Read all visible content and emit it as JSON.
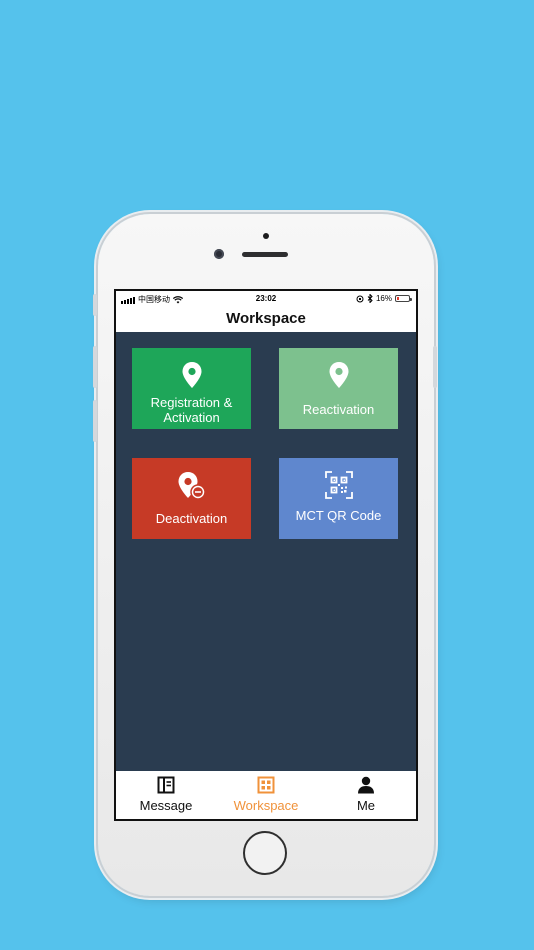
{
  "status_bar": {
    "carrier": "中国移动",
    "time": "23:02",
    "battery_percent": "16%",
    "battery_level": 0.16
  },
  "nav": {
    "title": "Workspace"
  },
  "tiles": [
    {
      "label": "Registration & Activation",
      "icon": "location-pin-icon",
      "color": "#1ea659"
    },
    {
      "label": "Reactivation",
      "icon": "location-pin-icon",
      "color": "#7dc18e"
    },
    {
      "label": "Deactivation",
      "icon": "location-pin-minus-icon",
      "color": "#c63a26"
    },
    {
      "label": "MCT QR Code",
      "icon": "qr-code-icon",
      "color": "#5f87ce"
    }
  ],
  "tabs": [
    {
      "label": "Message",
      "icon": "message-book-icon",
      "active": false
    },
    {
      "label": "Workspace",
      "icon": "workspace-grid-icon",
      "active": true
    },
    {
      "label": "Me",
      "icon": "person-icon",
      "active": false
    }
  ],
  "colors": {
    "background": "#55c2ec",
    "screen": "#2a3c50",
    "active_tab": "#f0923a"
  }
}
